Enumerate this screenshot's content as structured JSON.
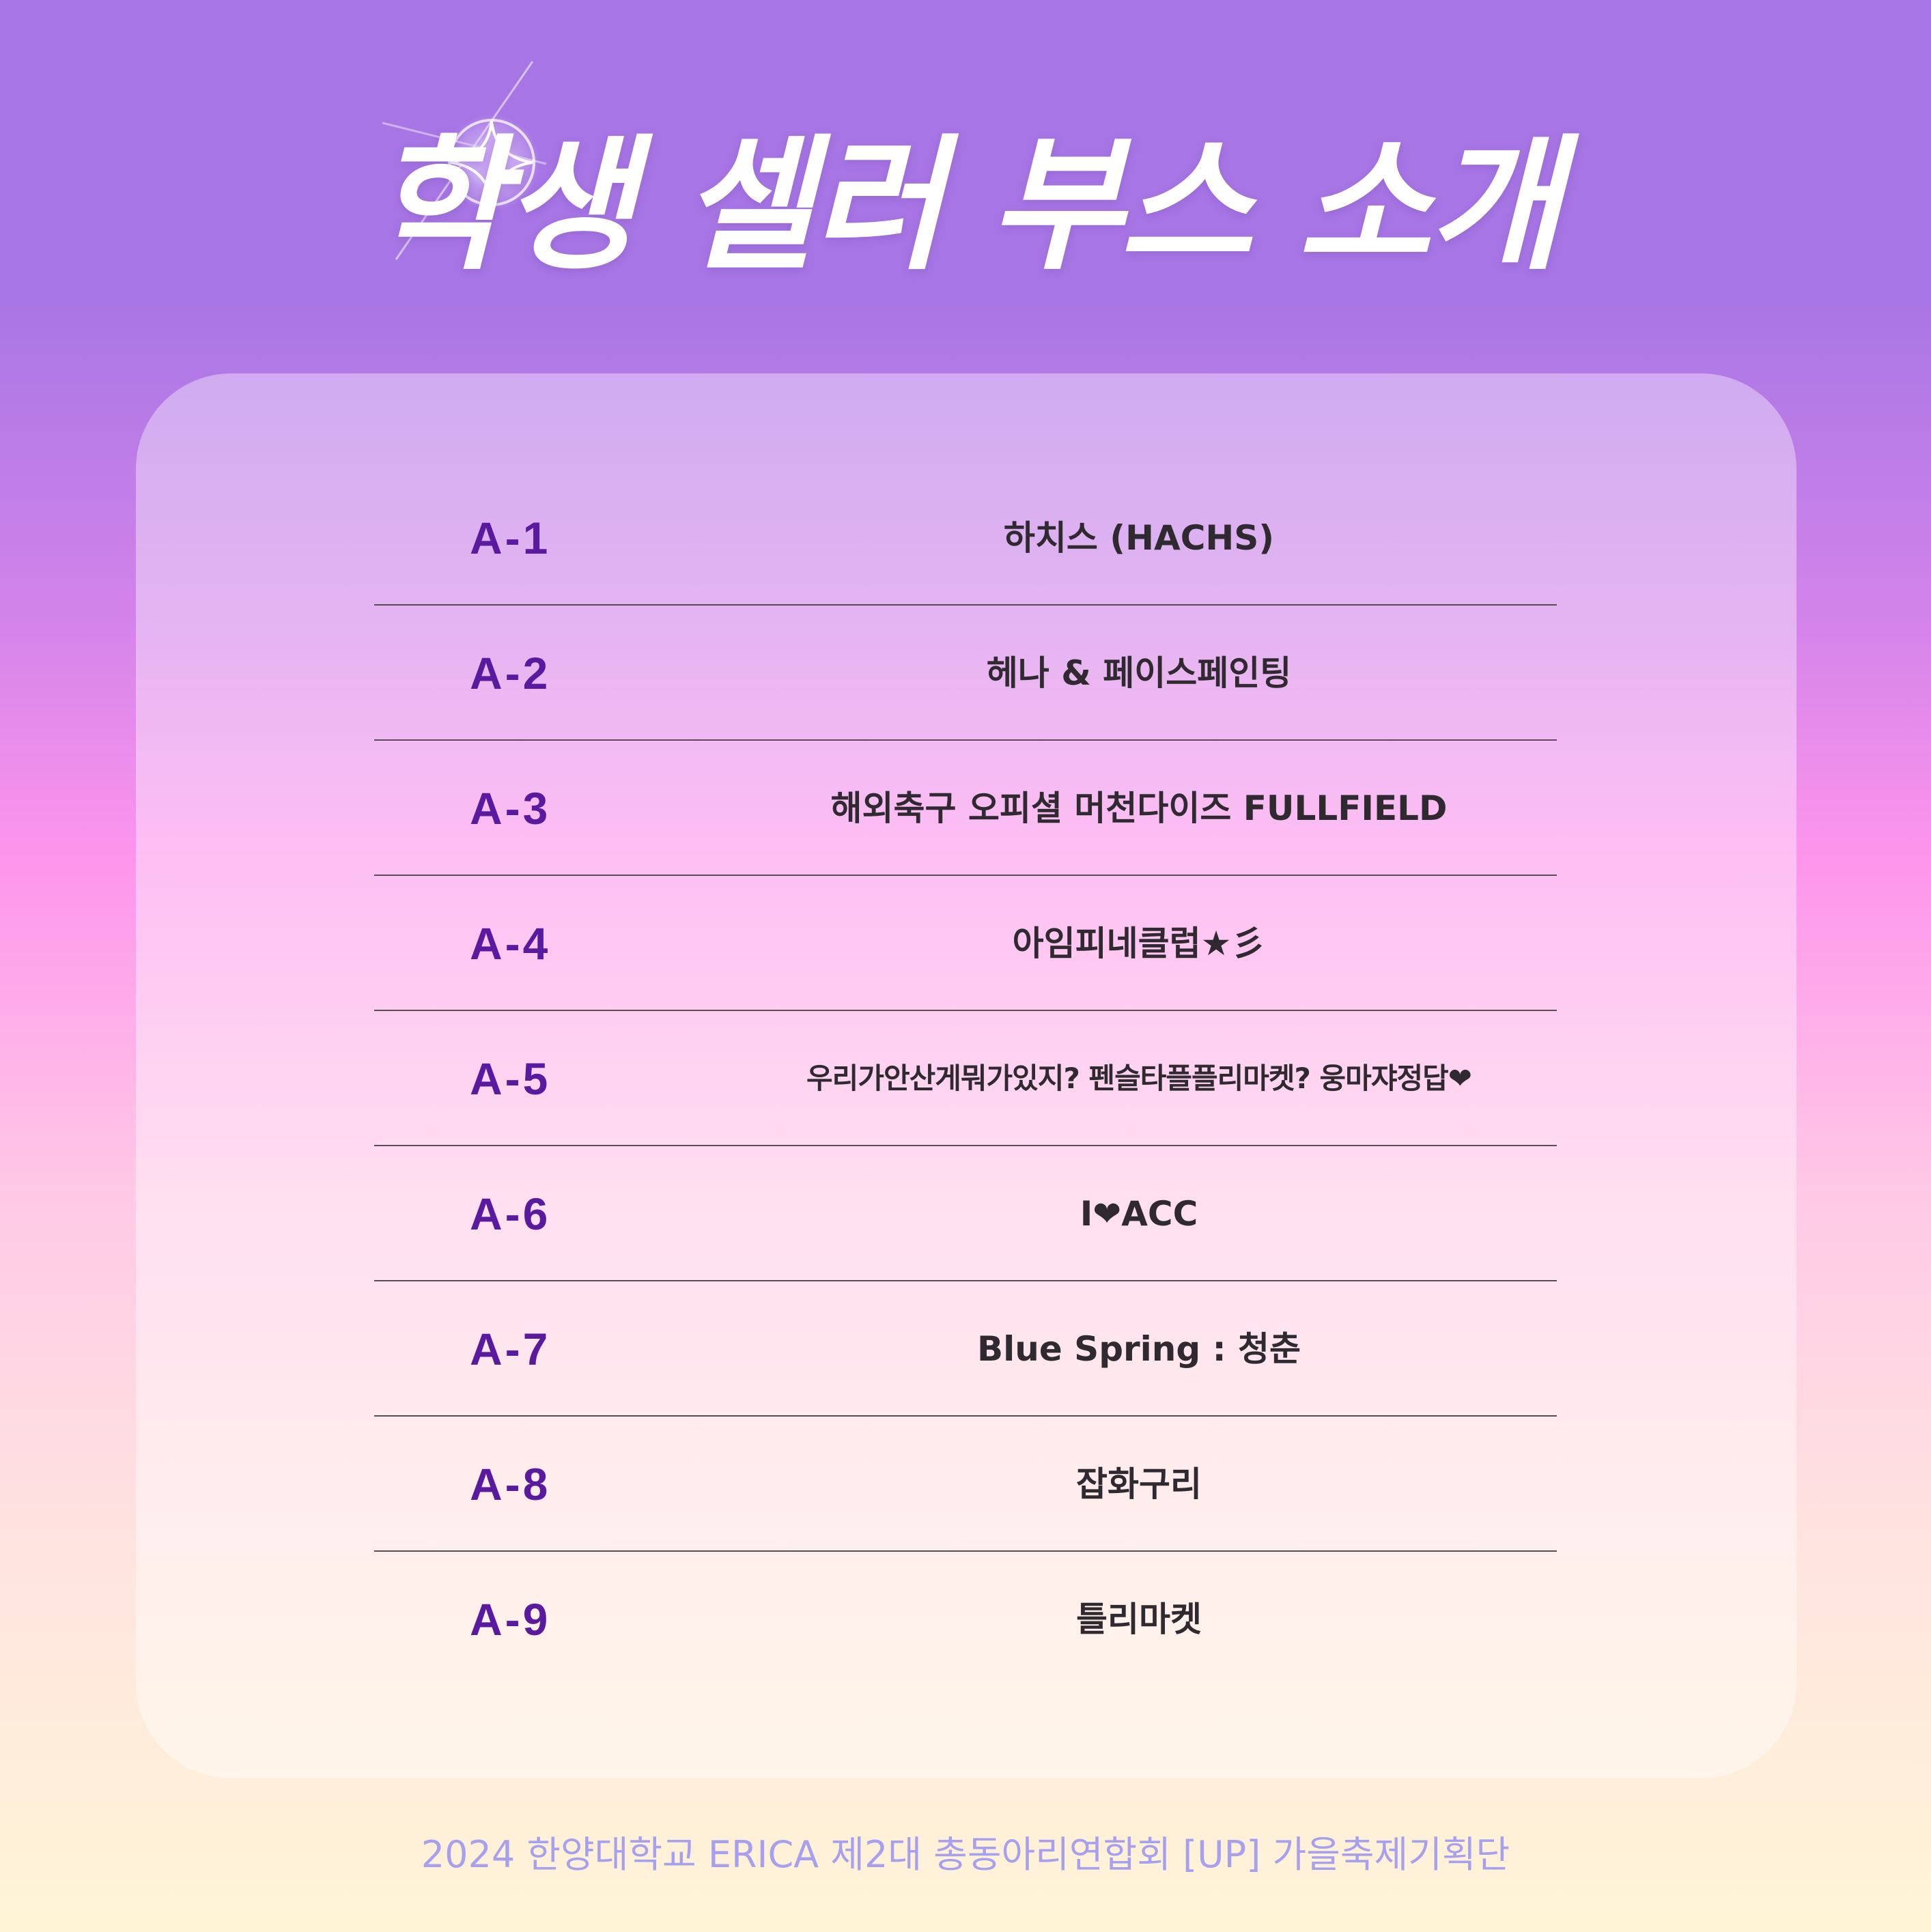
{
  "title": "학생 셀러 부스 소개",
  "booths": [
    {
      "code": "A-1",
      "name": "하치스 (HACHS)"
    },
    {
      "code": "A-2",
      "name": "헤나 & 페이스페인팅"
    },
    {
      "code": "A-3",
      "name": "해외축구 오피셜 머천다이즈 FULLFIELD"
    },
    {
      "code": "A-4",
      "name": "아임피네클럽★彡"
    },
    {
      "code": "A-5",
      "name": "우리가안산게뭐가있지? 펜슬타플플리마켓? 웅마쟈정답❤"
    },
    {
      "code": "A-6",
      "name": "I❤ACC"
    },
    {
      "code": "A-7",
      "name": "Blue Spring : 청춘"
    },
    {
      "code": "A-8",
      "name": "잡화구리"
    },
    {
      "code": "A-9",
      "name": "틀리마켓"
    }
  ],
  "footer": "2024 한양대학교 ERICA 제2대 총동아리연합회 [UP] 가을축제기획단",
  "colors": {
    "background_top": "#a776e4",
    "background_mid": "#fe95ec",
    "background_bottom": "#fff5d6",
    "code_text": "#5a1a9f",
    "name_text": "#2f2a30",
    "footer_text": "#a6a0ef"
  },
  "icons": {
    "title_decoration": "sparkle-icon"
  }
}
